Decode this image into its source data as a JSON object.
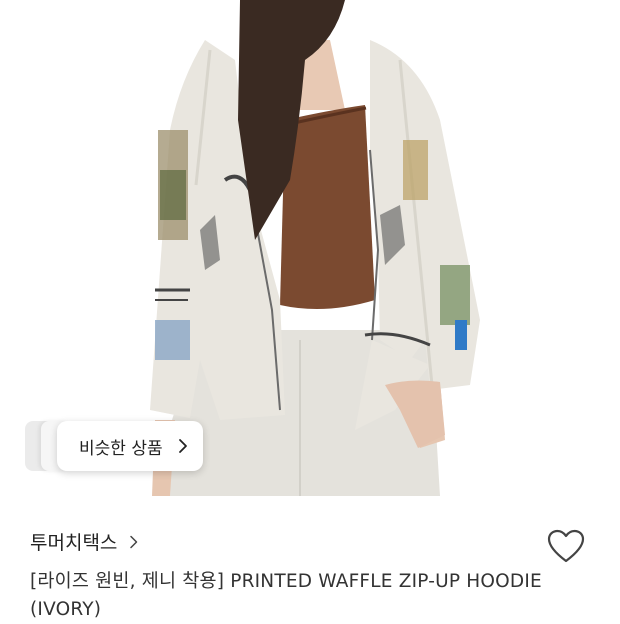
{
  "product_image": {
    "description_icon": "product-photo"
  },
  "similar_products": {
    "label": "비슷한 상품"
  },
  "brand": {
    "name": "투머치택스"
  },
  "product": {
    "title": "[라이즈 원빈, 제니 착용] PRINTED WAFFLE ZIP-UP HOODIE (IVORY)"
  },
  "colors": {
    "hoodie": "#e9e6df",
    "top": "#7b4a30",
    "hair": "#3a2a22",
    "skin": "#e8c9b4",
    "text": "#222222"
  }
}
